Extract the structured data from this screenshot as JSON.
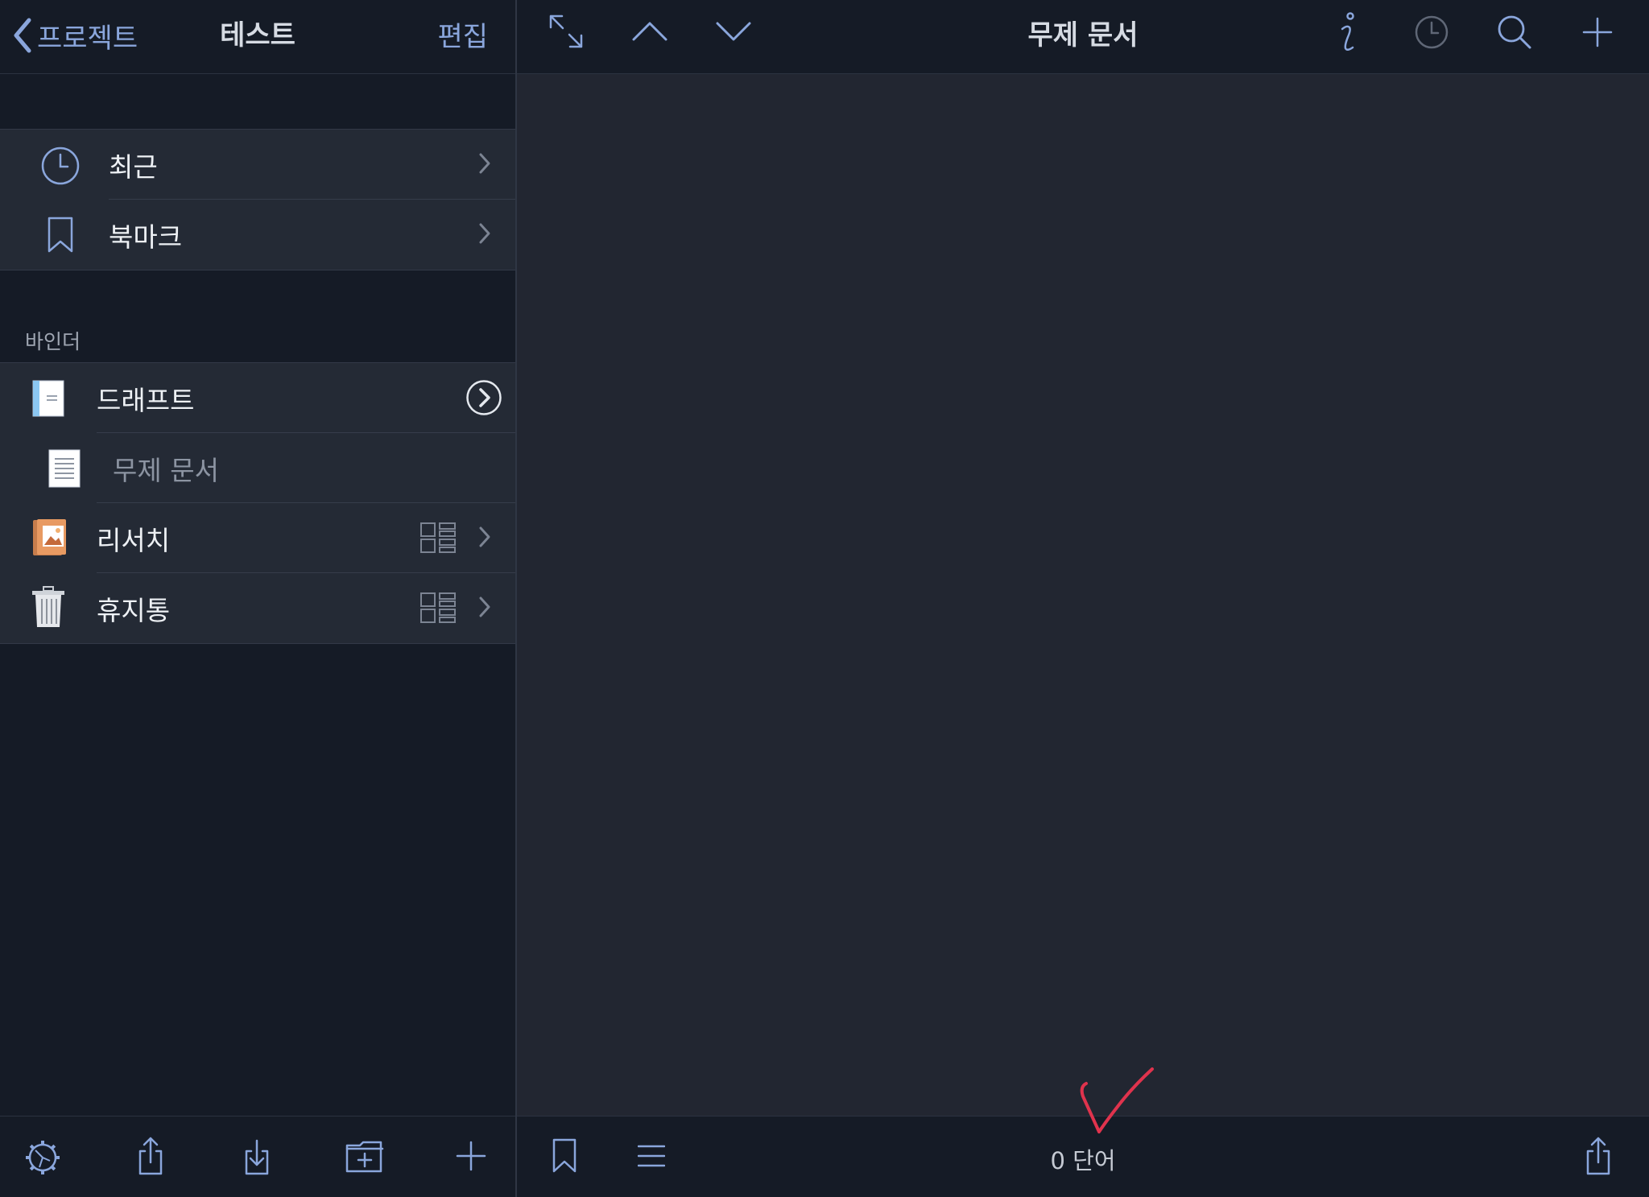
{
  "sidebar": {
    "header": {
      "back_label": "프로젝트",
      "title": "테스트",
      "edit_label": "편집"
    },
    "quick": [
      {
        "label": "최근",
        "icon": "clock-icon"
      },
      {
        "label": "북마크",
        "icon": "bookmark-icon"
      }
    ],
    "binder_header": "바인더",
    "binder": [
      {
        "label": "드래프트",
        "icon": "draft-folder-icon",
        "accessory": "circled-chevron-icon"
      },
      {
        "label": "무제 문서",
        "icon": "document-icon",
        "dimmed": true
      },
      {
        "label": "리서치",
        "icon": "research-folder-icon",
        "accessory": "grid-view-icon"
      },
      {
        "label": "휴지통",
        "icon": "trash-icon",
        "accessory": "grid-view-icon"
      }
    ],
    "toolbar": [
      "settings-gear-icon",
      "share-icon",
      "import-icon",
      "new-folder-icon",
      "add-icon"
    ]
  },
  "editor": {
    "title": "무제 문서",
    "toolbar_left": [
      "expand-icon",
      "previous-up-icon",
      "next-down-icon"
    ],
    "toolbar_right": [
      "info-icon",
      "history-clock-icon",
      "search-icon",
      "add-icon"
    ],
    "word_count": "0 단어",
    "bottom_left": [
      "bookmark-icon",
      "list-icon"
    ],
    "bottom_right": [
      "share-icon"
    ]
  },
  "colors": {
    "sidebar_bg": "#151b26",
    "row_bg": "#242a35",
    "editor_bg": "#222631",
    "accent": "#8aa6dc",
    "annotation": "#e0334d"
  }
}
